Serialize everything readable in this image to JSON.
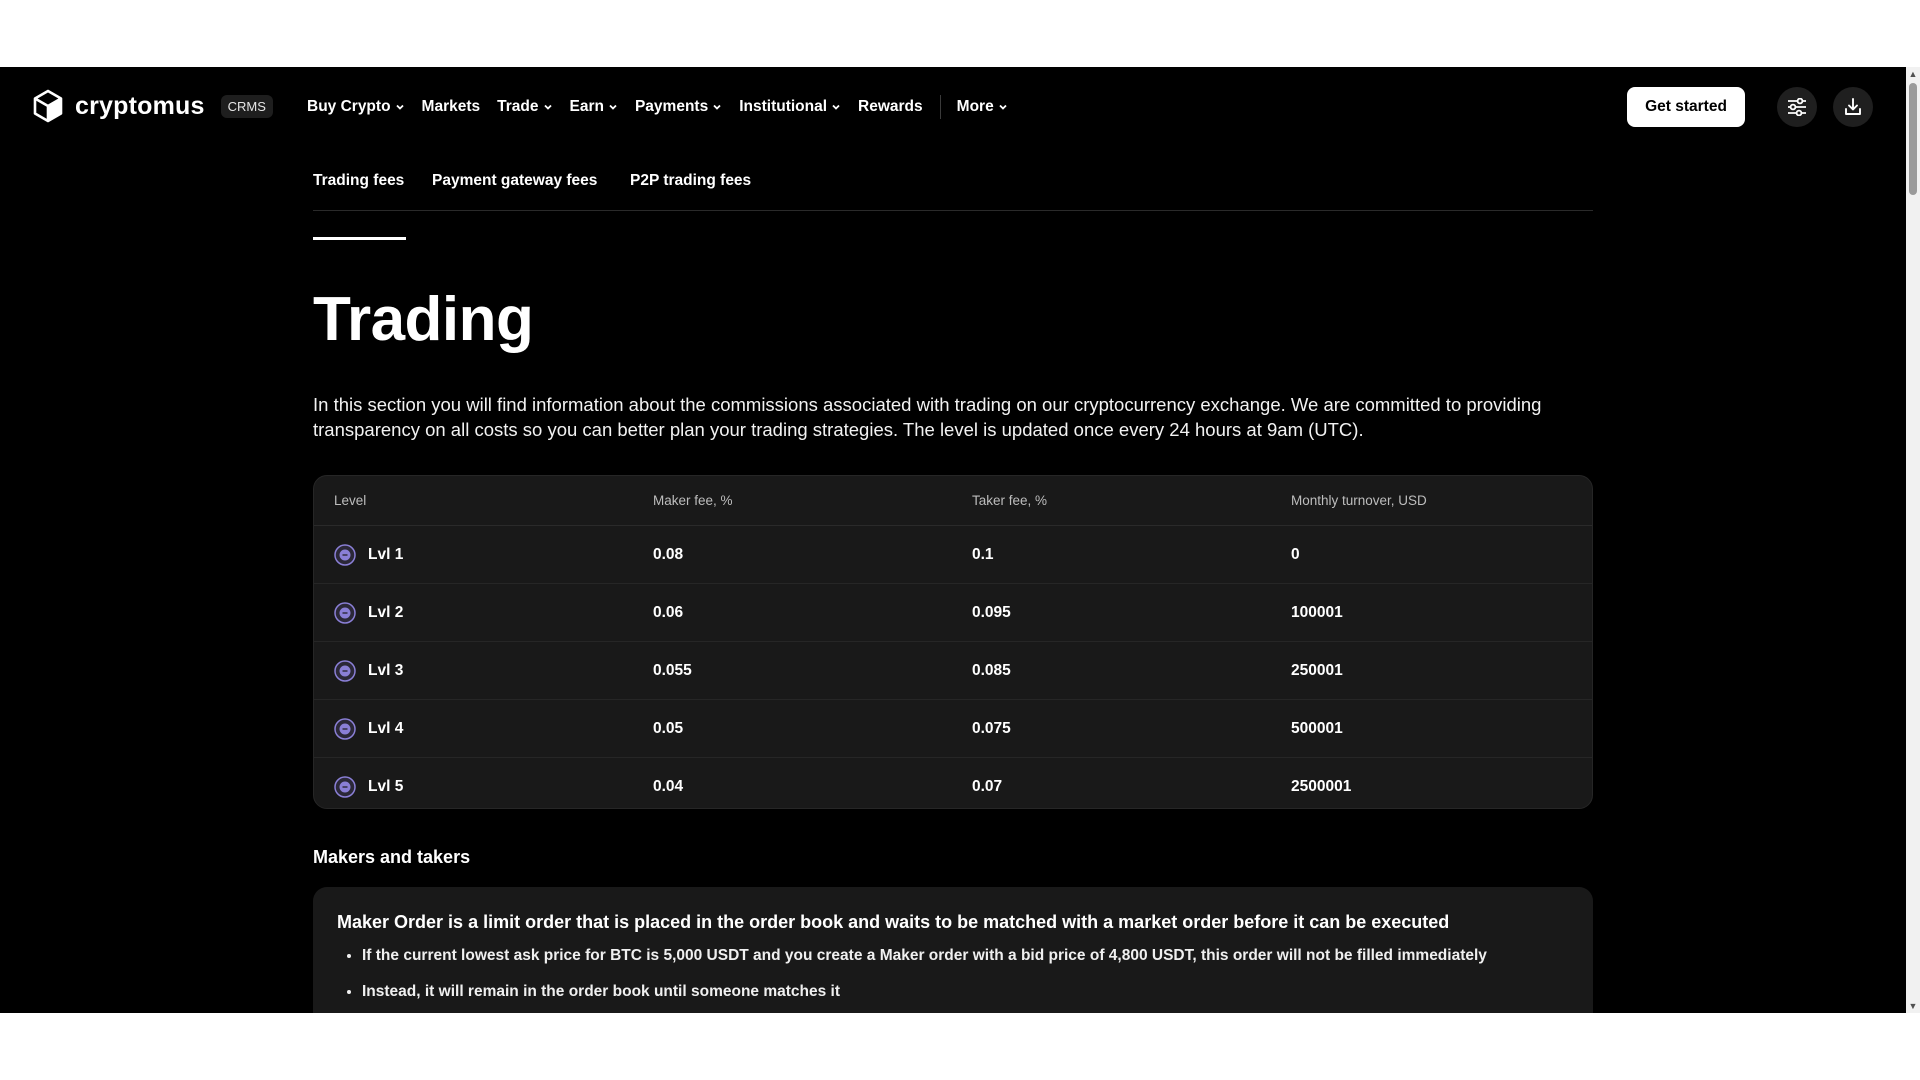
{
  "header": {
    "logo_text": "cryptomus",
    "badge": "CRMS",
    "nav": [
      {
        "label": "Buy Crypto",
        "dropdown": true
      },
      {
        "label": "Markets",
        "dropdown": false
      },
      {
        "label": "Trade",
        "dropdown": true
      },
      {
        "label": "Earn",
        "dropdown": true
      },
      {
        "label": "Payments",
        "dropdown": true
      },
      {
        "label": "Institutional",
        "dropdown": true
      },
      {
        "label": "Rewards",
        "dropdown": false
      },
      {
        "label": "More",
        "dropdown": true
      }
    ],
    "get_started": "Get started",
    "icons": {
      "settings": "sliders-icon",
      "download": "download-icon",
      "logo": "cube-logo-icon"
    }
  },
  "tabs": [
    {
      "label": "Trading fees",
      "active": true
    },
    {
      "label": "Payment gateway fees",
      "active": false
    },
    {
      "label": "P2P trading fees",
      "active": false
    }
  ],
  "page": {
    "title": "Trading",
    "description": "In this section you will find information about the commissions associated with trading on our cryptocurrency exchange. We are committed to providing transparency on all costs so you can better plan your trading strategies. The level is updated once every 24 hours at 9am (UTC)."
  },
  "table": {
    "headers": [
      "Level",
      "Maker fee, %",
      "Taker fee, %",
      "Monthly turnover, USD"
    ],
    "rows": [
      {
        "level": "Lvl 1",
        "maker": "0.08",
        "taker": "0.1",
        "turnover": "0"
      },
      {
        "level": "Lvl 2",
        "maker": "0.06",
        "taker": "0.095",
        "turnover": "100001"
      },
      {
        "level": "Lvl 3",
        "maker": "0.055",
        "taker": "0.085",
        "turnover": "250001"
      },
      {
        "level": "Lvl 4",
        "maker": "0.05",
        "taker": "0.075",
        "turnover": "500001"
      },
      {
        "level": "Lvl 5",
        "maker": "0.04",
        "taker": "0.07",
        "turnover": "2500001"
      }
    ]
  },
  "makers": {
    "section_title": "Makers and takers",
    "card_title": "Maker Order is a limit order that is placed in the order book and waits to be matched with a market order before it can be executed",
    "bullets": [
      "If the current lowest ask price for BTC is 5,000 USDT and you create a Maker order with a bid price of 4,800 USDT, this order will not be filled immediately",
      "Instead, it will remain in the order book until someone matches it"
    ]
  },
  "colors": {
    "background": "#000000",
    "card": "#191919",
    "accent": "#ffffff",
    "level_badge": "#8a7fd6"
  }
}
